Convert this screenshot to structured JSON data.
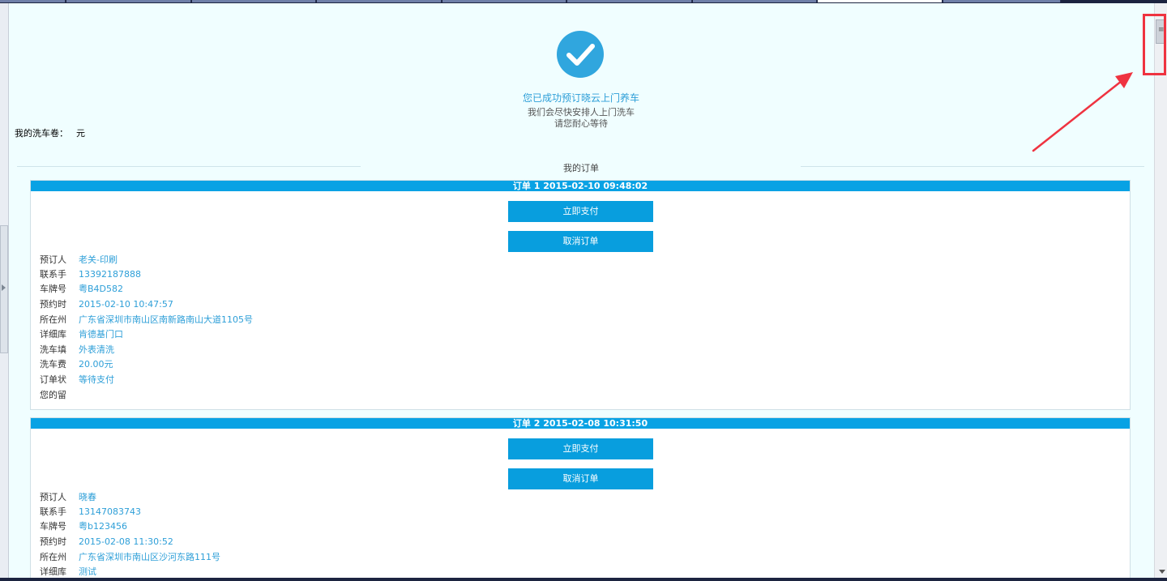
{
  "success": {
    "title": "您已成功预订晓云上门养车",
    "line1": "我们会尽快安排人上门洗车",
    "line2": "请您耐心等待"
  },
  "coupon": {
    "label": "我的洗车卷：",
    "value": "元"
  },
  "section_title": "我的订单",
  "orders": [
    {
      "header": "订单 1   2015-02-10 09:48:02",
      "pay_label": "立即支付",
      "cancel_label": "取消订单",
      "fields": [
        {
          "k": "预订人",
          "v": "老关-印刷"
        },
        {
          "k": "联系手",
          "v": "13392187888"
        },
        {
          "k": "车牌号",
          "v": "粤B4D582"
        },
        {
          "k": "预约时",
          "v": "2015-02-10 10:47:57"
        },
        {
          "k": "所在州",
          "v": "广东省深圳市南山区南新路南山大道1105号"
        },
        {
          "k": "详细库",
          "v": "肯德基门口"
        },
        {
          "k": "洗车填",
          "v": "外表清洗"
        },
        {
          "k": "洗车费",
          "v": "20.00元"
        },
        {
          "k": "订单状",
          "v": "等待支付"
        },
        {
          "k": "您的留",
          "v": ""
        }
      ]
    },
    {
      "header": "订单 2   2015-02-08 10:31:50",
      "pay_label": "立即支付",
      "cancel_label": "取消订单",
      "fields": [
        {
          "k": "预订人",
          "v": "晓春"
        },
        {
          "k": "联系手",
          "v": "13147083743"
        },
        {
          "k": "车牌号",
          "v": "粤b123456"
        },
        {
          "k": "预约时",
          "v": "2015-02-08 11:30:52"
        },
        {
          "k": "所在州",
          "v": "广东省深圳市南山区沙河东路111号"
        },
        {
          "k": "详细库",
          "v": "测试"
        }
      ]
    }
  ],
  "icons": {
    "success": "checkmark-circle-icon",
    "scroll_grip": "grip-icon",
    "scroll_down": "arrow-down-icon",
    "left_toggle": "chevron-right-icon"
  },
  "colors": {
    "accent": "#089ede",
    "page_bg": "#f0feff",
    "highlight": "#ef3340",
    "value_text": "#2e9fd8"
  }
}
